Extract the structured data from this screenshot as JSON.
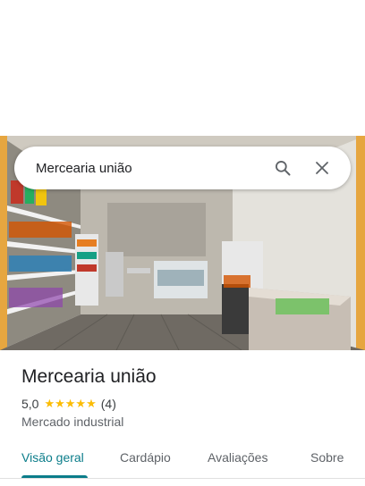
{
  "search": {
    "query": "Mercearia união"
  },
  "place": {
    "name": "Mercearia união",
    "rating": "5,0",
    "stars": "★★★★★",
    "review_count": "(4)",
    "category": "Mercado industrial"
  },
  "tabs": [
    {
      "label": "Visão geral",
      "active": true
    },
    {
      "label": "Cardápio",
      "active": false
    },
    {
      "label": "Avaliações",
      "active": false
    },
    {
      "label": "Sobre",
      "active": false
    }
  ],
  "colors": {
    "accent": "#0b7d8a",
    "star": "#fbbc04"
  },
  "icons": [
    "search-icon",
    "close-icon"
  ]
}
